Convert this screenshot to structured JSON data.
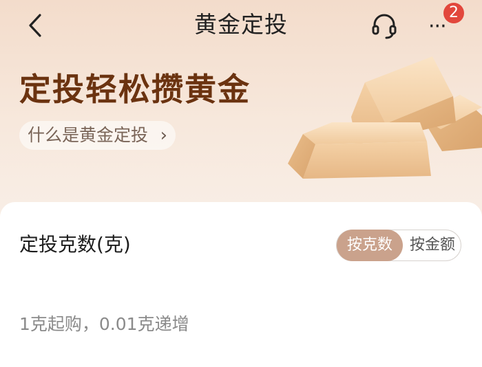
{
  "header": {
    "title": "黄金定投",
    "more_label": "···",
    "notification_count": "2"
  },
  "hero": {
    "title": "定投轻松攒黄金",
    "link_label": "什么是黄金定投",
    "link_chevron": "›"
  },
  "form": {
    "label": "定投克数(克)",
    "toggle": {
      "selected": "按克数",
      "other": "按金额"
    },
    "hint": "1克起购，0.01克递增"
  },
  "colors": {
    "accent": "#caa28c",
    "hero_text": "#6b3310",
    "badge": "#e2473c"
  },
  "icons": [
    "chevron-left-icon",
    "headset-icon",
    "more-icon",
    "gold-bars-illustration"
  ]
}
